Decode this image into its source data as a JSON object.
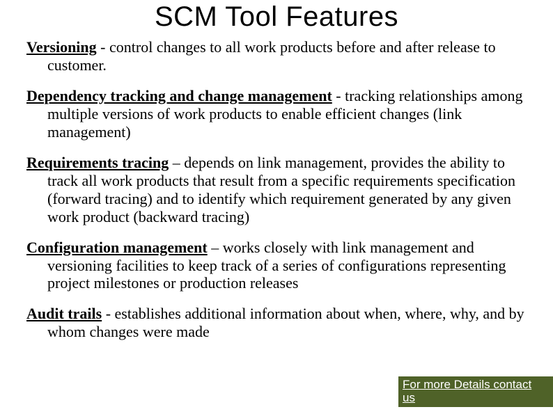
{
  "title": "SCM Tool Features",
  "features": [
    {
      "term": "Versioning",
      "sep": " - ",
      "desc": "control changes to all work products before and after release to customer."
    },
    {
      "term": "Dependency tracking and change management",
      "sep": " - ",
      "desc": "tracking relationships among multiple versions of work products to enable efficient changes (link management)"
    },
    {
      "term": "Requirements tracing",
      "sep": " – ",
      "desc": "depends on link management, provides the ability to track all work products that result from a specific requirements specification (forward tracing) and to identify which requirement generated by any given work product (backward tracing)"
    },
    {
      "term": "Configuration management",
      "sep": " – ",
      "desc": "works closely with link management and versioning facilities to keep track of a series of configurations representing project milestones or production releases"
    },
    {
      "term": "Audit trails",
      "sep": " -  ",
      "desc": "establishes additional information about when, where, why, and by whom changes were made"
    }
  ],
  "contact": {
    "line1": "For more Details contact",
    "line2": "us"
  }
}
